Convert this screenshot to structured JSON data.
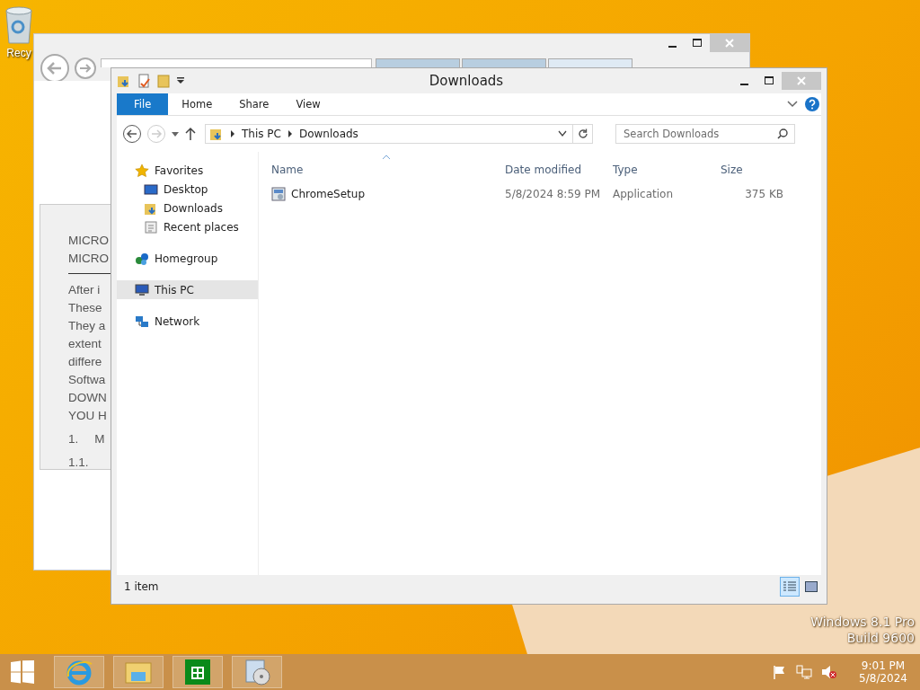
{
  "desktop": {
    "icons": [
      {
        "label": "Recy"
      }
    ],
    "edition": [
      "Windows 8.1 Pro",
      "Build 9600"
    ]
  },
  "browser": {
    "tabs": [
      {
        "selected": false
      },
      {
        "selected": false
      },
      {
        "selected": true
      }
    ],
    "heading_lines": [
      "MICRO",
      "MICRO"
    ],
    "paragraph_lines": [
      "After i",
      "These",
      "They a",
      "extent",
      "differe",
      "Softwa",
      "DOWN",
      "YOU H"
    ],
    "list_items": [
      {
        "number": "1.",
        "text": "M"
      },
      {
        "number": "1.1."
      }
    ]
  },
  "explorer": {
    "title": "Downloads",
    "ribbon_tabs": [
      {
        "label": "File",
        "kind": "file",
        "selected": false
      },
      {
        "label": "Home",
        "kind": "tab",
        "selected": false
      },
      {
        "label": "Share",
        "kind": "tab",
        "selected": false
      },
      {
        "label": "View",
        "kind": "tab",
        "selected": false
      }
    ],
    "breadcrumb": [
      "This PC",
      "Downloads"
    ],
    "search": {
      "placeholder": "Search Downloads"
    },
    "nav": [
      {
        "label": "Favorites",
        "kind": "star",
        "selected": false,
        "children": [
          {
            "label": "Desktop",
            "kind": "desktop",
            "selected": false
          },
          {
            "label": "Downloads",
            "kind": "folder",
            "selected": false
          },
          {
            "label": "Recent places",
            "kind": "recent",
            "selected": false
          }
        ]
      },
      {
        "label": "Homegroup",
        "kind": "homegroup",
        "selected": false
      },
      {
        "label": "This PC",
        "kind": "pc",
        "selected": true
      },
      {
        "label": "Network",
        "kind": "network",
        "selected": false
      }
    ],
    "columns": [
      {
        "label": "Name",
        "sorted": true
      },
      {
        "label": "Date modified",
        "sorted": false
      },
      {
        "label": "Type",
        "sorted": false
      },
      {
        "label": "Size",
        "sorted": false
      }
    ],
    "rows": [
      {
        "name": "ChromeSetup",
        "date": "5/8/2024 8:59 PM",
        "type": "Application",
        "size": "375 KB"
      }
    ],
    "status": "1 item",
    "views": [
      {
        "kind": "details",
        "selected": true
      },
      {
        "kind": "thumbs",
        "selected": false
      }
    ]
  },
  "taskbar": {
    "apps": [
      {
        "kind": "ie"
      },
      {
        "kind": "explorer"
      },
      {
        "kind": "store"
      },
      {
        "kind": "setup"
      }
    ],
    "time": "9:01 PM",
    "date": "5/8/2024"
  }
}
